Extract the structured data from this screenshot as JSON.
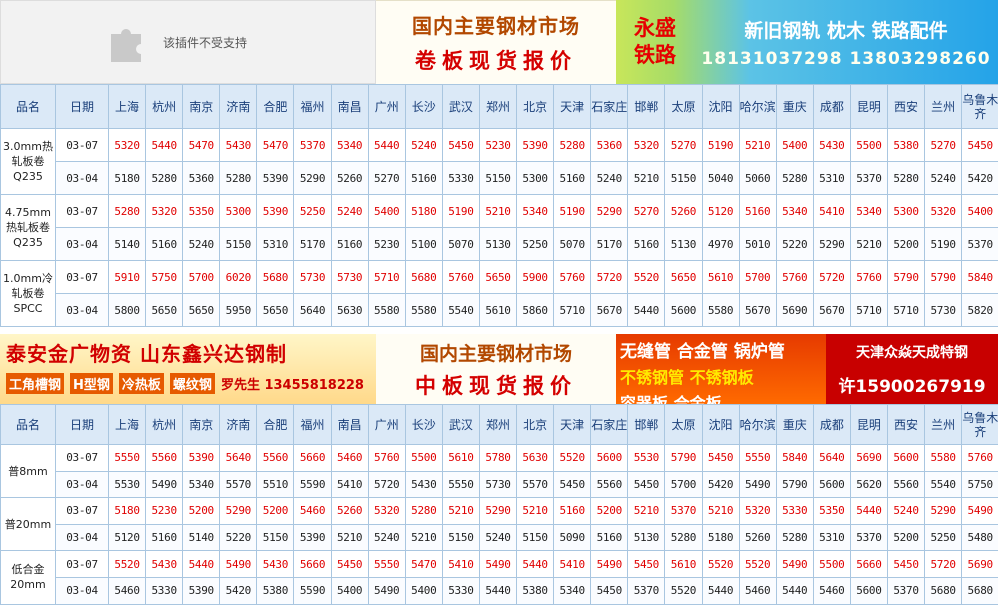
{
  "plugin": {
    "text": "该插件不受支持"
  },
  "ad_market": {
    "line1": "国内主要钢材市场",
    "line2": "卷板现货报价"
  },
  "ad_rail": {
    "brand": "永盛\n铁路",
    "title": "新旧钢轨 枕木 铁路配件",
    "phones": "18131037298 13803298260"
  },
  "ad_steel1": {
    "title": "泰安金广物资 山东鑫兴达钢制",
    "items": [
      "工角槽钢",
      "H型钢",
      "冷热板",
      "螺纹钢"
    ],
    "contact": "罗先生 13455818228"
  },
  "ad_plate": {
    "line1": "国内主要钢材市场",
    "line2": "中板现货报价"
  },
  "ad_pipe": {
    "line1": "无缝管 合金管 锅炉管",
    "line2": "不锈钢管 不锈钢板",
    "line3": "容器板 合金板"
  },
  "ad_tj": {
    "line1": "天津众焱天成特钢",
    "line2": "许15900267919"
  },
  "colors": {
    "current_price": "#e00000",
    "header_bg": "#dbe9f7",
    "border": "#a9c6e0"
  },
  "headers": [
    "品名",
    "日期",
    "上海",
    "杭州",
    "南京",
    "济南",
    "合肥",
    "福州",
    "南昌",
    "广州",
    "长沙",
    "武汉",
    "郑州",
    "北京",
    "天津",
    "石家庄",
    "邯郸",
    "太原",
    "沈阳",
    "哈尔滨",
    "重庆",
    "成都",
    "昆明",
    "西安",
    "兰州",
    "乌鲁木齐"
  ],
  "table1": {
    "rows": [
      {
        "name": "3.0mm热轧板卷Q235",
        "current": {
          "date": "03-07",
          "prices": [
            "5320",
            "5440",
            "5470",
            "5430",
            "5470",
            "5370",
            "5340",
            "5440",
            "5240",
            "5450",
            "5230",
            "5390",
            "5280",
            "5360",
            "5320",
            "5270",
            "5190",
            "5210",
            "5400",
            "5430",
            "5500",
            "5380",
            "5270",
            "5450"
          ]
        },
        "previous": {
          "date": "03-04",
          "prices": [
            "5180",
            "5280",
            "5360",
            "5280",
            "5390",
            "5290",
            "5260",
            "5270",
            "5160",
            "5330",
            "5150",
            "5300",
            "5160",
            "5240",
            "5210",
            "5150",
            "5040",
            "5060",
            "5280",
            "5310",
            "5370",
            "5280",
            "5240",
            "5420"
          ]
        }
      },
      {
        "name": "4.75mm热轧板卷Q235",
        "current": {
          "date": "03-07",
          "prices": [
            "5280",
            "5320",
            "5350",
            "5300",
            "5390",
            "5250",
            "5240",
            "5400",
            "5180",
            "5190",
            "5210",
            "5340",
            "5190",
            "5290",
            "5270",
            "5260",
            "5120",
            "5160",
            "5340",
            "5410",
            "5340",
            "5300",
            "5320",
            "5400"
          ]
        },
        "previous": {
          "date": "03-04",
          "prices": [
            "5140",
            "5160",
            "5240",
            "5150",
            "5310",
            "5170",
            "5160",
            "5230",
            "5100",
            "5070",
            "5130",
            "5250",
            "5070",
            "5170",
            "5160",
            "5130",
            "4970",
            "5010",
            "5220",
            "5290",
            "5210",
            "5200",
            "5190",
            "5370"
          ]
        }
      },
      {
        "name": "1.0mm冷轧板卷SPCC",
        "current": {
          "date": "03-07",
          "prices": [
            "5910",
            "5750",
            "5700",
            "6020",
            "5680",
            "5730",
            "5730",
            "5710",
            "5680",
            "5760",
            "5650",
            "5900",
            "5760",
            "5720",
            "5520",
            "5650",
            "5610",
            "5700",
            "5760",
            "5720",
            "5760",
            "5790",
            "5790",
            "5840"
          ]
        },
        "previous": {
          "date": "03-04",
          "prices": [
            "5800",
            "5650",
            "5650",
            "5950",
            "5650",
            "5640",
            "5630",
            "5580",
            "5580",
            "5540",
            "5610",
            "5860",
            "5710",
            "5670",
            "5440",
            "5600",
            "5580",
            "5670",
            "5690",
            "5670",
            "5710",
            "5710",
            "5730",
            "5820"
          ]
        }
      }
    ]
  },
  "table2": {
    "rows": [
      {
        "name": "普8mm",
        "current": {
          "date": "03-07",
          "prices": [
            "5550",
            "5560",
            "5390",
            "5640",
            "5560",
            "5660",
            "5460",
            "5760",
            "5500",
            "5610",
            "5780",
            "5630",
            "5520",
            "5600",
            "5530",
            "5790",
            "5450",
            "5550",
            "5840",
            "5640",
            "5690",
            "5600",
            "5580",
            "5760"
          ]
        },
        "previous": {
          "date": "03-04",
          "prices": [
            "5530",
            "5490",
            "5340",
            "5570",
            "5510",
            "5590",
            "5410",
            "5720",
            "5430",
            "5550",
            "5730",
            "5570",
            "5450",
            "5560",
            "5450",
            "5700",
            "5420",
            "5490",
            "5790",
            "5600",
            "5620",
            "5560",
            "5540",
            "5750"
          ]
        }
      },
      {
        "name": "普20mm",
        "current": {
          "date": "03-07",
          "prices": [
            "5180",
            "5230",
            "5200",
            "5290",
            "5200",
            "5460",
            "5260",
            "5320",
            "5280",
            "5210",
            "5290",
            "5210",
            "5160",
            "5200",
            "5210",
            "5370",
            "5210",
            "5320",
            "5330",
            "5350",
            "5440",
            "5240",
            "5290",
            "5490"
          ]
        },
        "previous": {
          "date": "03-04",
          "prices": [
            "5120",
            "5160",
            "5140",
            "5220",
            "5150",
            "5390",
            "5210",
            "5240",
            "5210",
            "5150",
            "5240",
            "5150",
            "5090",
            "5160",
            "5130",
            "5280",
            "5180",
            "5260",
            "5280",
            "5310",
            "5370",
            "5200",
            "5250",
            "5480"
          ]
        }
      },
      {
        "name": "低合金20mm",
        "current": {
          "date": "03-07",
          "prices": [
            "5520",
            "5430",
            "5440",
            "5490",
            "5430",
            "5660",
            "5450",
            "5550",
            "5470",
            "5410",
            "5490",
            "5440",
            "5410",
            "5490",
            "5450",
            "5610",
            "5520",
            "5520",
            "5490",
            "5500",
            "5660",
            "5450",
            "5720",
            "5690"
          ]
        },
        "previous": {
          "date": "03-04",
          "prices": [
            "5460",
            "5330",
            "5390",
            "5420",
            "5380",
            "5590",
            "5400",
            "5490",
            "5400",
            "5330",
            "5440",
            "5380",
            "5340",
            "5450",
            "5370",
            "5520",
            "5440",
            "5460",
            "5440",
            "5460",
            "5600",
            "5370",
            "5680",
            "5680"
          ]
        }
      }
    ]
  }
}
